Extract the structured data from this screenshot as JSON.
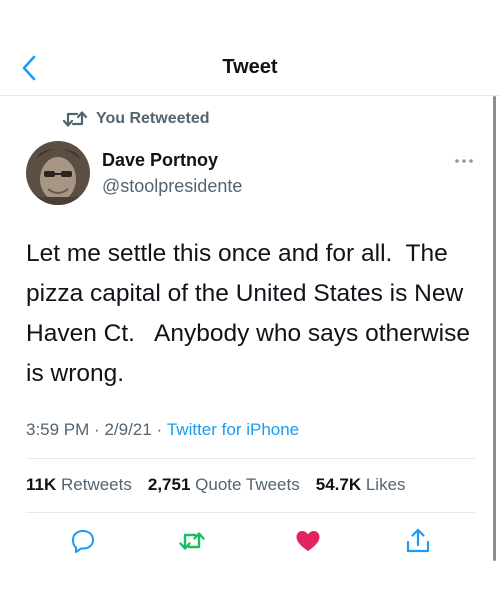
{
  "header": {
    "title": "Tweet"
  },
  "retweet": {
    "label": "You Retweeted"
  },
  "author": {
    "name": "Dave Portnoy",
    "handle": "@stoolpresidente"
  },
  "tweet": {
    "text": "Let me settle this once and for all.  The pizza capital of the United States is New Haven Ct.   Anybody who says otherwise is wrong.",
    "time": "3:59 PM",
    "separator": "·",
    "date": "2/9/21",
    "source": "Twitter for iPhone"
  },
  "stats": {
    "retweets_count": "11K",
    "retweets_label": "Retweets",
    "quotes_count": "2,751",
    "quotes_label": "Quote Tweets",
    "likes_count": "54.7K",
    "likes_label": "Likes"
  },
  "colors": {
    "accent": "#1d9bf0",
    "retweet_green": "#17bf63",
    "like_red": "#e0245e",
    "muted": "#536471"
  },
  "icons": {
    "back": "chevron-left-icon",
    "retweet": "retweet-icon",
    "more": "more-horizontal-icon",
    "reply": "reply-icon",
    "retweet_action": "retweet-icon",
    "like": "heart-icon",
    "share": "share-icon"
  }
}
